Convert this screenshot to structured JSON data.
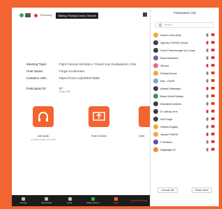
{
  "meeting": {
    "recording_label": "Recording...",
    "talking_label": "Talking: Pankaj Kumar, Vishant",
    "info": [
      {
        "label": "Meeting Topic:",
        "value": "Fight Corona GirlAdom / Grand Jury Evaluations | Stor"
      },
      {
        "label": "Host Name:",
        "value": "Forge Accelerator"
      },
      {
        "label": "Invitation URL:",
        "value": "https://zoom.us/j/485374559"
      },
      {
        "label": "Participant ID:",
        "value": "97"
      }
    ],
    "copy_url": "Copy URL",
    "tiles": [
      {
        "title": "Join Audio",
        "subtitle": "Computer audio connected"
      },
      {
        "title": "Share Screen",
        "subtitle": ""
      },
      {
        "title": "Invite",
        "subtitle": ""
      }
    ]
  },
  "toolbar": {
    "items": [
      {
        "label": "Unmute",
        "icon": "mic-icon"
      },
      {
        "label": "Start Video",
        "icon": "video-icon"
      },
      {
        "label": "Invite",
        "icon": "invite-icon"
      },
      {
        "label": "Share Screen",
        "icon": "share-screen-icon"
      },
      {
        "label": "More",
        "icon": "more-icon"
      }
    ],
    "leave_label": "Leave Meeting"
  },
  "panel": {
    "title": "Participants (19)",
    "search_placeholder": "Search",
    "participants": [
      {
        "name": "Sachin Gaur (Me)",
        "color": "#f3a83b"
      },
      {
        "name": "Vignesh FORGE (Host)",
        "color": "#3a3f4a"
      },
      {
        "name": "Vivek Premchanger (Co-host)",
        "color": "#3a3f4a"
      },
      {
        "name": "Elias Wachtsell",
        "color": "#7a5ba8"
      },
      {
        "name": "Vikrant",
        "color": "#e46b8b"
      },
      {
        "name": "Pankaj Kumar",
        "color": "#f3a83b"
      },
      {
        "name": "Nair - FAGE",
        "color": "#7aa2d8"
      },
      {
        "name": "Adarsh Natarajan",
        "color": "#3a3f4a"
      },
      {
        "name": "Barry World Startup",
        "color": "#4a8b5c"
      },
      {
        "name": "deepakinnovators",
        "color": "#3a3f4a"
      },
      {
        "name": "Dr. Abhay Jere",
        "color": "#3a3f4a"
      },
      {
        "name": "Neil Forge",
        "color": "#3a3f4a"
      },
      {
        "name": "Harsha Angara",
        "color": "#f3a83b"
      },
      {
        "name": "Janani FORGE",
        "color": "#f3a83b"
      },
      {
        "name": "S Ila Banu",
        "color": "#5f4bb6"
      },
      {
        "name": "Nagarajan M",
        "color": "#e98a3b"
      }
    ],
    "footer": {
      "unmute_me": "Unmute Me",
      "raise_hand": "Raise Hand"
    }
  }
}
